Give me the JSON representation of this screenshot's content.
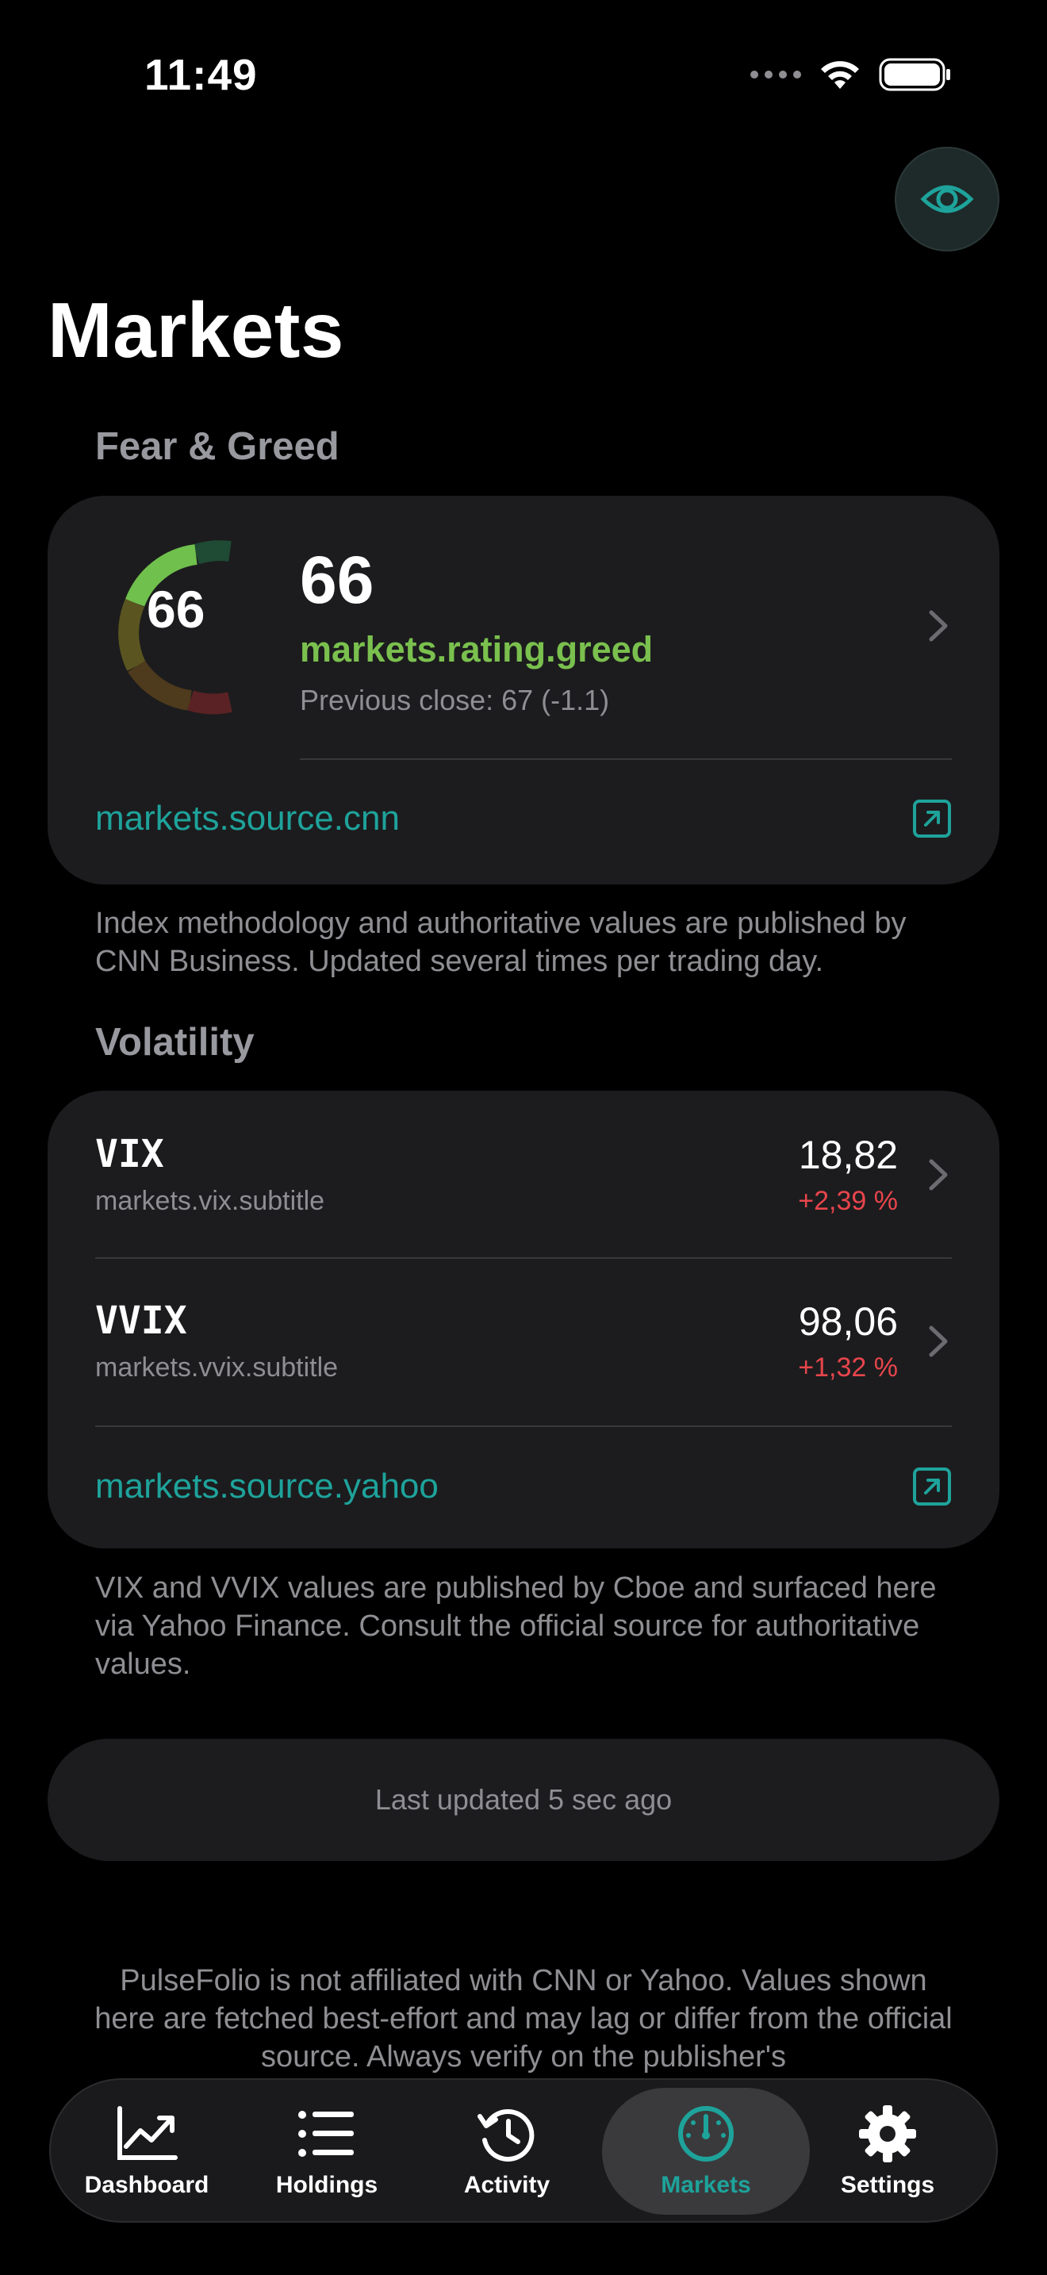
{
  "status_bar": {
    "time": "11:49"
  },
  "page": {
    "title": "Markets"
  },
  "fear_greed": {
    "section_title": "Fear & Greed",
    "gauge_value": "66",
    "score": "66",
    "rating": "markets.rating.greed",
    "previous_close": "Previous close: 67 (-1.1)",
    "source_link": "markets.source.cnn",
    "footnote": "Index methodology and authoritative values are published by CNN Business. Updated several times per trading day.",
    "rating_color": "#7ac04e"
  },
  "volatility": {
    "section_title": "Volatility",
    "rows": [
      {
        "ticker": "VIX",
        "subtitle": "markets.vix.subtitle",
        "value": "18,82",
        "change": "+2,39 %"
      },
      {
        "ticker": "VVIX",
        "subtitle": "markets.vvix.subtitle",
        "value": "98,06",
        "change": "+1,32 %"
      }
    ],
    "source_link": "markets.source.yahoo",
    "footnote": "VIX and VVIX values are published by Cboe and surfaced here via Yahoo Finance. Consult the official source for authoritative values.",
    "change_color": "#e8454c"
  },
  "last_updated": "Last updated 5 sec ago",
  "disclaimer": "PulseFolio is not affiliated with CNN or Yahoo. Values shown here are fetched best-effort and may lag or differ from the official source. Always verify on the publisher's",
  "tabs": [
    {
      "label": "Dashboard",
      "icon": "chart-line-icon"
    },
    {
      "label": "Holdings",
      "icon": "list-icon"
    },
    {
      "label": "Activity",
      "icon": "history-icon"
    },
    {
      "label": "Markets",
      "icon": "gauge-icon",
      "active": true
    },
    {
      "label": "Settings",
      "icon": "gear-icon"
    }
  ],
  "colors": {
    "accent": "#1ea39b",
    "card": "#1c1c1e",
    "background": "#000000"
  }
}
